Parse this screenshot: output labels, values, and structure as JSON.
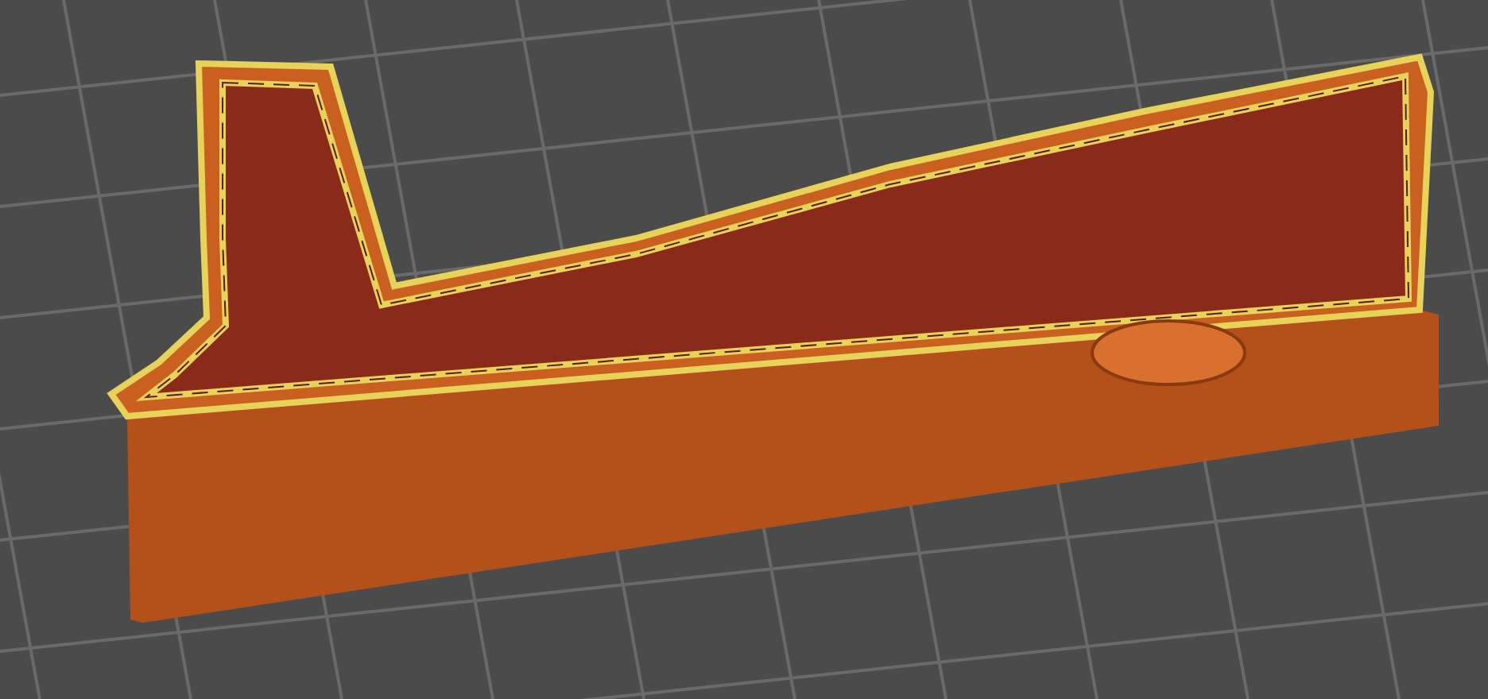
{
  "viewport": {
    "kind": "layer_preview"
  }
}
